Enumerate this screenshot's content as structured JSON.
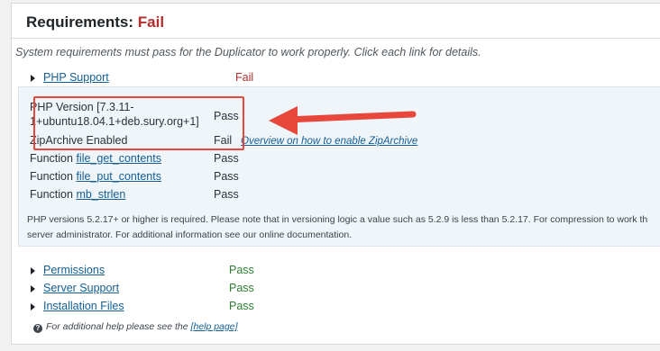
{
  "header": {
    "title": "Requirements:",
    "status": "Fail",
    "status_color": "#b32d2e"
  },
  "intro": "System requirements must pass for the Duplicator to work properly. Click each link for details.",
  "sections": {
    "php_support": {
      "label": "PHP Support",
      "status": "Fail"
    },
    "permissions": {
      "label": "Permissions",
      "status": "Pass"
    },
    "server_support": {
      "label": "Server Support",
      "status": "Pass"
    },
    "installation_files": {
      "label": "Installation Files",
      "status": "Pass"
    }
  },
  "php_details": {
    "php_version_line1": "PHP Version [7.3.11-",
    "php_version_line2": "1+ubuntu18.04.1+deb.sury.org+1]",
    "php_version_status": "Pass",
    "ziparchive_label": "ZipArchive Enabled",
    "ziparchive_status": "Fail",
    "ziparchive_help_link": "Overview on how to enable ZipArchive",
    "functions": [
      {
        "prefix": "Function",
        "name": "file_get_contents",
        "status": "Pass"
      },
      {
        "prefix": "Function",
        "name": "file_put_contents",
        "status": "Pass"
      },
      {
        "prefix": "Function",
        "name": "mb_strlen",
        "status": "Pass"
      }
    ],
    "note_line1": "PHP versions 5.2.17+ or higher is required. Please note that in versioning logic a value such as 5.2.9 is less than 5.2.17. For compression to work th",
    "note_line2": "server administrator. For additional information see our online documentation."
  },
  "help": {
    "text": "For additional help please see the",
    "link": "[help page]"
  },
  "annotation": {
    "color": "#e8473b"
  },
  "icons": {
    "expand": "triangle-right-icon",
    "help": "question-circle-icon"
  }
}
